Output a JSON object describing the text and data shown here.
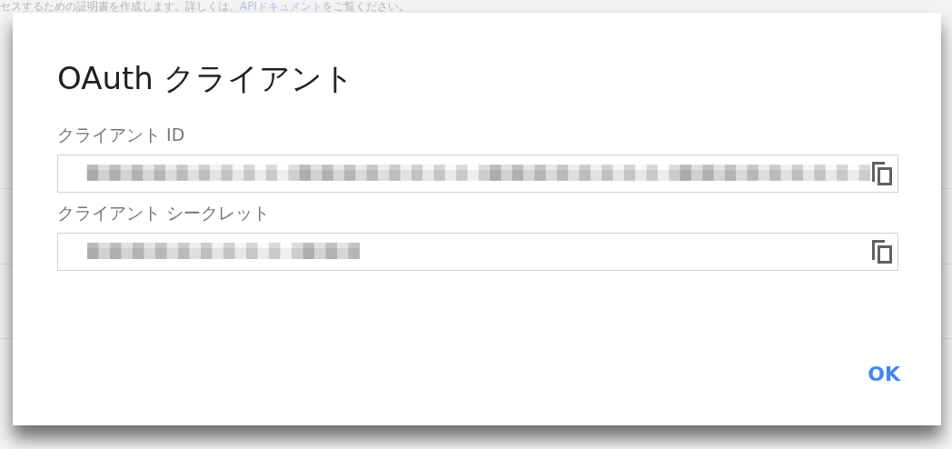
{
  "background": {
    "intro_before": "セスするための証明書を作成します。詳しくは、",
    "intro_link": "APIドキュメント",
    "intro_after": "をご覧ください。"
  },
  "dialog": {
    "title": "OAuth クライアント",
    "fields": [
      {
        "label": "クライアント ID",
        "kind": "long"
      },
      {
        "label": "クライアント シークレット",
        "kind": "short"
      }
    ],
    "button": "OK"
  }
}
